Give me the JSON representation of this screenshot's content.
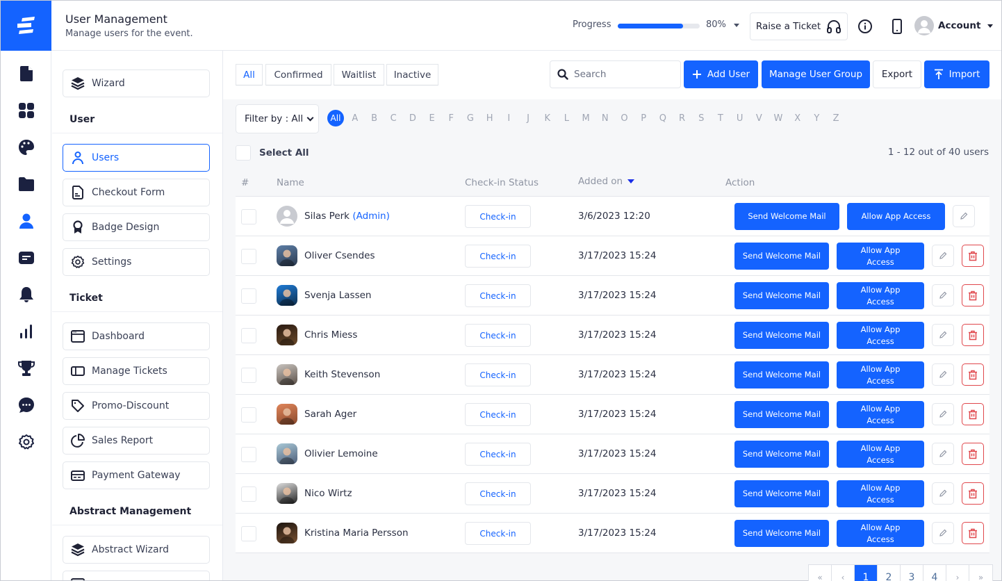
{
  "header": {
    "title": "User Management",
    "subtitle": "Manage users for the event.",
    "progress_label": "Progress",
    "progress_value": 0.8,
    "progress_text": "80%",
    "raise_ticket_label": "Raise a Ticket",
    "account_label": "Account"
  },
  "rail": {
    "items": [
      {
        "icon": "document-icon"
      },
      {
        "icon": "grid-icon"
      },
      {
        "icon": "palette-icon"
      },
      {
        "icon": "folder-icon"
      },
      {
        "icon": "user-icon",
        "active": true
      },
      {
        "icon": "card-icon"
      },
      {
        "icon": "bell-icon"
      },
      {
        "icon": "bar-chart-icon"
      },
      {
        "icon": "trophy-icon"
      },
      {
        "icon": "chat-icon"
      },
      {
        "icon": "gear-icon"
      }
    ]
  },
  "subnav": {
    "wizard": "Wizard",
    "sections": [
      {
        "title": "User",
        "items": [
          "Users",
          "Checkout Form",
          "Badge Design",
          "Settings"
        ]
      },
      {
        "title": "Ticket",
        "items": [
          "Dashboard",
          "Manage Tickets",
          "Promo-Discount",
          "Sales Report",
          "Payment Gateway"
        ]
      },
      {
        "title": "Abstract Management",
        "items": [
          "Abstract Wizard"
        ]
      }
    ],
    "active": "Users"
  },
  "tabs": [
    "All",
    "Confirmed",
    "Waitlist",
    "Inactive"
  ],
  "active_tab": "All",
  "toolbar": {
    "search_placeholder": "Search",
    "add_user": "Add User",
    "manage_group": "Manage User Group",
    "export": "Export",
    "import": "Import"
  },
  "filter": {
    "selected": "Filter by : All",
    "alphabet": [
      "All",
      "A",
      "B",
      "C",
      "D",
      "E",
      "F",
      "G",
      "H",
      "I",
      "J",
      "K",
      "L",
      "M",
      "N",
      "O",
      "P",
      "Q",
      "R",
      "S",
      "T",
      "U",
      "V",
      "W",
      "X",
      "Y",
      "Z"
    ],
    "active_letter": "All"
  },
  "select_all_label": "Select All",
  "count_text": "1 - 12 out of 40 users",
  "table": {
    "columns": [
      "#",
      "Name",
      "Check-in Status",
      "Added on",
      "Action"
    ],
    "sort_column": "Added on",
    "checkin_label": "Check-in",
    "send_mail_label": "Send Welcome Mail",
    "allow_access_label": "Allow App Access",
    "rows": [
      {
        "name": "Silas Perk",
        "tag": "(Admin)",
        "added": "3/6/2023 12:20",
        "avatar": "placeholder",
        "deletable": false
      },
      {
        "name": "Oliver Csendes",
        "tag": "",
        "added": "3/17/2023 15:24",
        "avatar": "photo",
        "deletable": true
      },
      {
        "name": "Svenja Lassen",
        "tag": "",
        "added": "3/17/2023 15:24",
        "avatar": "photo",
        "deletable": true
      },
      {
        "name": "Chris Miess",
        "tag": "",
        "added": "3/17/2023 15:24",
        "avatar": "photo",
        "deletable": true
      },
      {
        "name": "Keith Stevenson",
        "tag": "",
        "added": "3/17/2023 15:24",
        "avatar": "photo",
        "deletable": true
      },
      {
        "name": "Sarah Ager",
        "tag": "",
        "added": "3/17/2023 15:24",
        "avatar": "photo",
        "deletable": true
      },
      {
        "name": "Olivier Lemoine",
        "tag": "",
        "added": "3/17/2023 15:24",
        "avatar": "photo",
        "deletable": true
      },
      {
        "name": "Nico Wirtz",
        "tag": "",
        "added": "3/17/2023 15:24",
        "avatar": "photo",
        "deletable": true
      },
      {
        "name": "Kristina Maria Persson",
        "tag": "",
        "added": "3/17/2023 15:24",
        "avatar": "photo",
        "deletable": true
      }
    ]
  },
  "pagination": {
    "first": "«",
    "prev": "‹",
    "pages": [
      "1",
      "2",
      "3",
      "4"
    ],
    "active": "1",
    "next": "›",
    "last": "»"
  },
  "colors": {
    "accent": "#1463ff",
    "danger": "#e0474c",
    "text": "#1f2235"
  }
}
